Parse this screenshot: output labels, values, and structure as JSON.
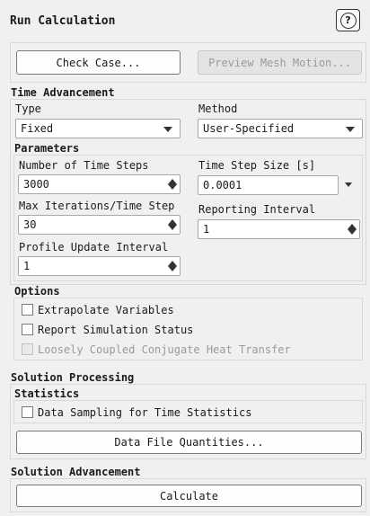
{
  "panel": {
    "title": "Run Calculation",
    "help_icon": "?"
  },
  "top_buttons": {
    "check_case": "Check Case...",
    "preview_mesh": "Preview Mesh Motion..."
  },
  "time_advancement": {
    "heading": "Time Advancement",
    "type_label": "Type",
    "type_value": "Fixed",
    "method_label": "Method",
    "method_value": "User-Specified"
  },
  "parameters": {
    "heading": "Parameters",
    "num_steps_label": "Number of Time Steps",
    "num_steps_value": "3000",
    "step_size_label": "Time Step Size [s]",
    "step_size_value": "0.0001",
    "max_iter_label": "Max Iterations/Time Step",
    "max_iter_value": "30",
    "report_interval_label": "Reporting Interval",
    "report_interval_value": "1",
    "profile_label": "Profile Update Interval",
    "profile_value": "1"
  },
  "options": {
    "heading": "Options",
    "extrapolate": "Extrapolate Variables",
    "report_status": "Report Simulation Status",
    "loosely_coupled": "Loosely Coupled Conjugate Heat Transfer"
  },
  "solution_processing": {
    "heading": "Solution Processing",
    "statistics_heading": "Statistics",
    "data_sampling": "Data Sampling for Time Statistics",
    "data_file_button": "Data File Quantities..."
  },
  "solution_advancement": {
    "heading": "Solution Advancement",
    "calculate_button": "Calculate"
  }
}
